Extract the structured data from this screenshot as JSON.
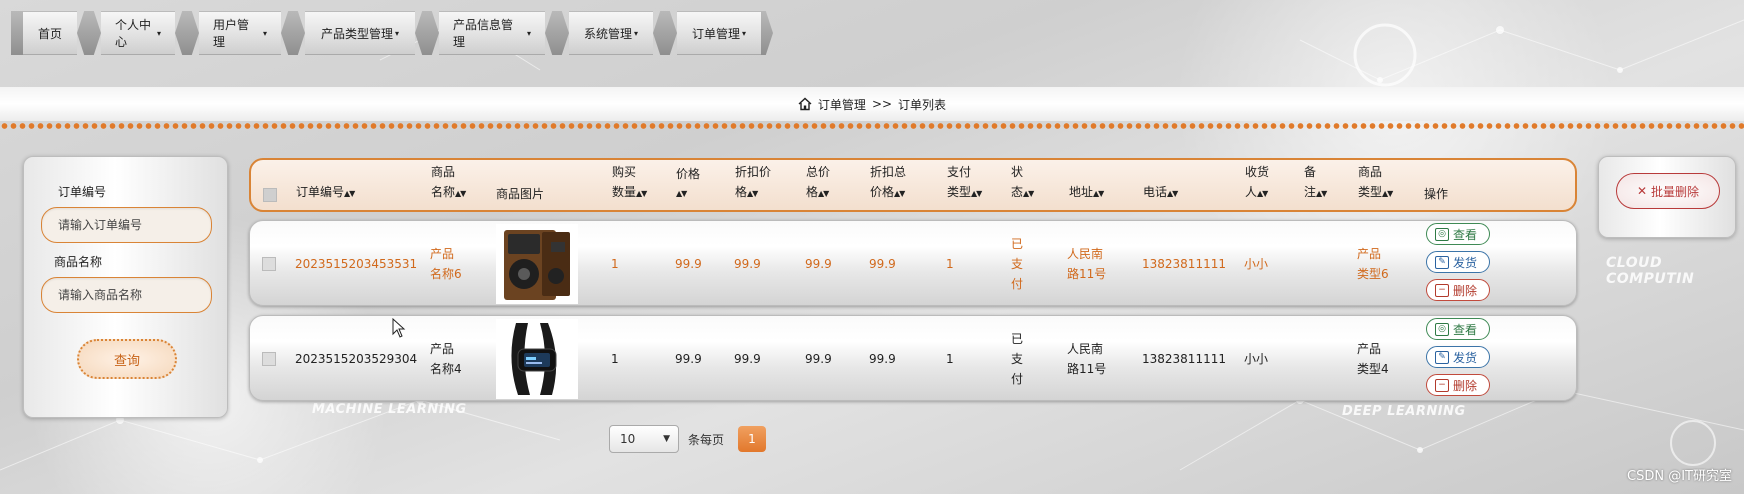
{
  "nav": {
    "items": [
      {
        "label": "首页",
        "caret": false
      },
      {
        "label": "个人中心",
        "caret": true
      },
      {
        "label": "用户管理",
        "caret": true
      },
      {
        "label": "产品类型管理",
        "caret": true
      },
      {
        "label": "产品信息管理",
        "caret": true
      },
      {
        "label": "系统管理",
        "caret": true
      },
      {
        "label": "订单管理",
        "caret": true
      }
    ],
    "caret_glyph": "▾"
  },
  "breadcrumb": {
    "icon": "home-icon",
    "section": "订单管理",
    "separator": ">>",
    "page": "订单列表"
  },
  "search": {
    "order_no_label": "订单编号",
    "order_no_placeholder": "请输入订单编号",
    "product_name_label": "商品名称",
    "product_name_placeholder": "请输入商品名称",
    "query_label": "查询"
  },
  "batch_delete": {
    "label": "批量删除",
    "icon": "close-icon"
  },
  "table": {
    "columns": {
      "order_no": "订单编号",
      "product_name_1": "商品",
      "product_name_2": "名称",
      "image": "商品图片",
      "qty_1": "购买",
      "qty_2": "数量",
      "price_1": "价格",
      "discount_price_1": "折扣价",
      "discount_price_2": "格",
      "total_1": "总价",
      "total_2": "格",
      "discount_total_1": "折扣总",
      "discount_total_2": "价格",
      "pay_type_1": "支付",
      "pay_type_2": "类型",
      "status_1": "状",
      "status_2": "态",
      "address": "地址",
      "phone": "电话",
      "receiver_1": "收货",
      "receiver_2": "人",
      "remark_1": "备",
      "remark_2": "注",
      "product_type_1": "商品",
      "product_type_2": "类型",
      "actions": "操作"
    },
    "sort_glyph": "▲▼",
    "rows": [
      {
        "order_no": "2023515203453531",
        "product_name_1": "产品",
        "product_name_2": "名称6",
        "image": "speaker-image",
        "qty": "1",
        "price": "99.9",
        "discount_price": "99.9",
        "total": "99.9",
        "discount_total": "99.9",
        "pay_type": "1",
        "status_1": "已",
        "status_2": "支",
        "status_3": "付",
        "address_1": "人民南",
        "address_2": "路11号",
        "phone": "13823811111",
        "receiver": "小小",
        "remark": "",
        "product_type_1": "产品",
        "product_type_2": "类型6",
        "highlight": true
      },
      {
        "order_no": "2023515203529304",
        "product_name_1": "产品",
        "product_name_2": "名称4",
        "image": "smartband-image",
        "qty": "1",
        "price": "99.9",
        "discount_price": "99.9",
        "total": "99.9",
        "discount_total": "99.9",
        "pay_type": "1",
        "status_1": "已",
        "status_2": "支",
        "status_3": "付",
        "address_1": "人民南",
        "address_2": "路11号",
        "phone": "13823811111",
        "receiver": "小小",
        "remark": "",
        "product_type_1": "产品",
        "product_type_2": "类型4",
        "highlight": false
      }
    ],
    "actions": {
      "view": "查看",
      "ship": "发货",
      "delete": "删除"
    }
  },
  "pagination": {
    "page_size": "10",
    "per_page_label": "条每页",
    "current_page": "1"
  },
  "background_text": {
    "cloud": "CLOUD COMPUTIN",
    "ml": "MACHINE LEARNING",
    "dl": "DEEP LEARNING"
  },
  "watermark": "CSDN @IT研究室",
  "colors": {
    "accent": "#d98436",
    "highlight_text": "#d1691c",
    "danger": "#b83a3a"
  }
}
